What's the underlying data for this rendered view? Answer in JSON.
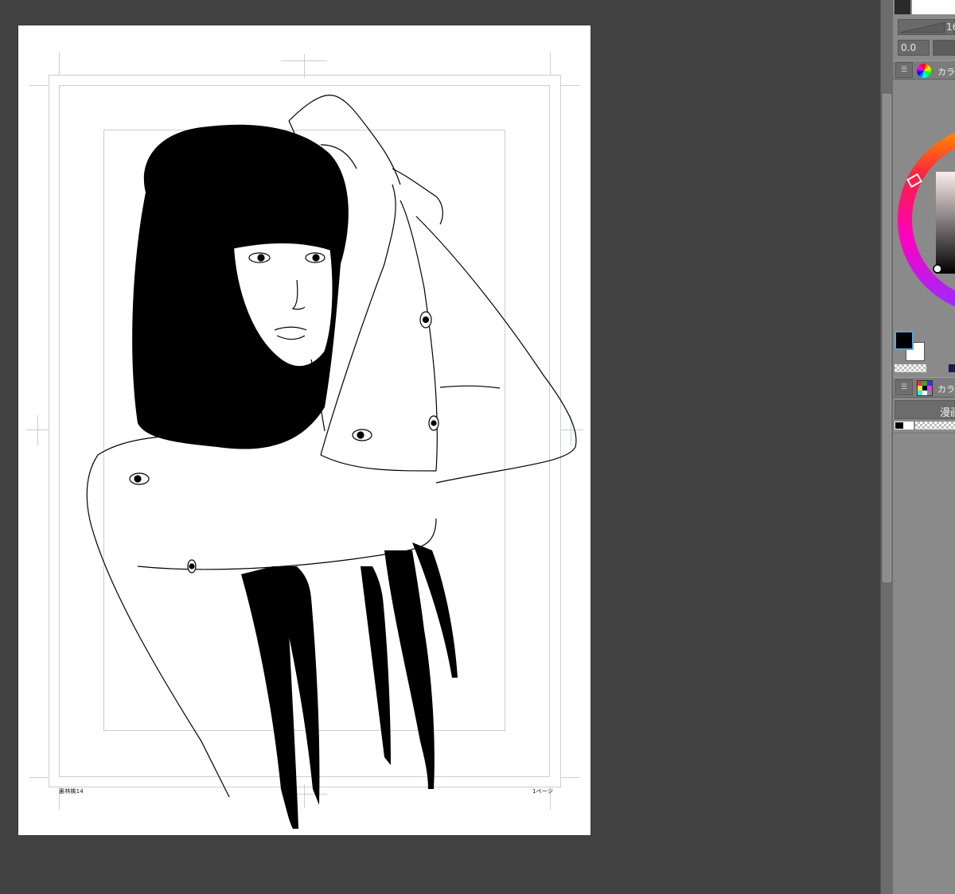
{
  "canvas": {
    "page": {
      "footer_left": "裏林檎14",
      "footer_right": "1ページ"
    },
    "artwork": {
      "subject": "ink-illustration-long-haired-figure",
      "colors": {
        "ink": "#000000",
        "paper": "#ffffff",
        "guide": "#c9cdd8"
      }
    }
  },
  "panel": {
    "brush_size_value": "16",
    "opacity_value": "0.0",
    "color_wheel_panel": {
      "title": "カラー",
      "icon": "color-wheel-icon"
    },
    "color_set_panel": {
      "title": "カラー",
      "icon": "color-set-icon",
      "set_name": "漫画"
    },
    "main_color": "#000000",
    "sub_color": "#ffffff",
    "accent": "#5aa7d6"
  }
}
